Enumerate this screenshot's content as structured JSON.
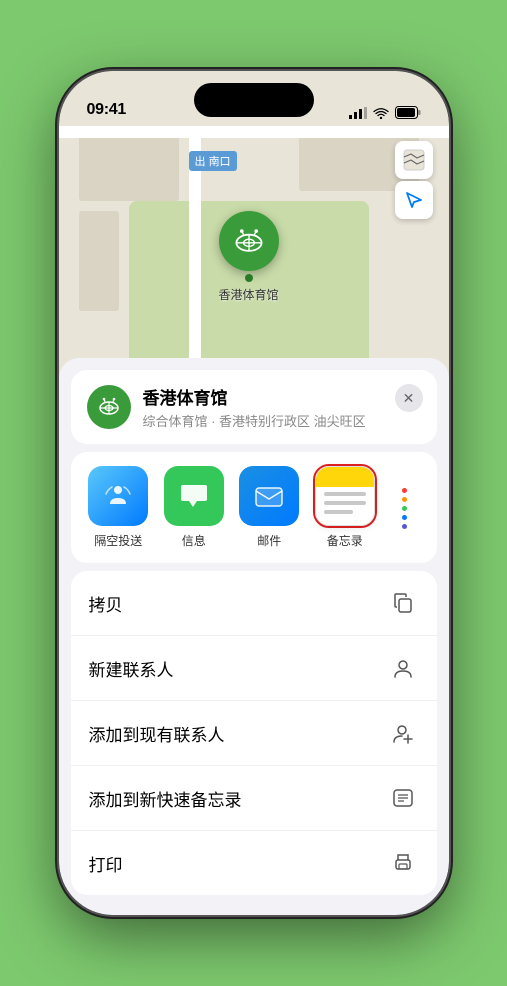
{
  "statusBar": {
    "time": "09:41",
    "locationArrow": "▶"
  },
  "map": {
    "labelText": "南口",
    "labelPrefix": "出"
  },
  "mapButtons": {
    "mapIcon": "🗺",
    "locationIcon": "➤"
  },
  "locationPin": {
    "name": "香港体育馆",
    "pinLabel": "香港体育馆"
  },
  "locationCard": {
    "name": "香港体育馆",
    "description": "综合体育馆 · 香港特别行政区 油尖旺区",
    "closeLabel": "✕"
  },
  "shareApps": [
    {
      "id": "airdrop",
      "label": "隔空投送",
      "type": "airdrop"
    },
    {
      "id": "messages",
      "label": "信息",
      "type": "messages"
    },
    {
      "id": "mail",
      "label": "邮件",
      "type": "mail"
    },
    {
      "id": "notes",
      "label": "备忘录",
      "type": "notes"
    }
  ],
  "moreColors": [
    "#ff3b30",
    "#ff9500",
    "#34c759",
    "#007aff",
    "#5856d6"
  ],
  "actions": [
    {
      "id": "copy",
      "label": "拷贝",
      "iconName": "copy-icon"
    },
    {
      "id": "new-contact",
      "label": "新建联系人",
      "iconName": "new-contact-icon"
    },
    {
      "id": "add-contact",
      "label": "添加到现有联系人",
      "iconName": "add-contact-icon"
    },
    {
      "id": "quick-note",
      "label": "添加到新快速备忘录",
      "iconName": "quick-note-icon"
    },
    {
      "id": "print",
      "label": "打印",
      "iconName": "print-icon"
    }
  ]
}
